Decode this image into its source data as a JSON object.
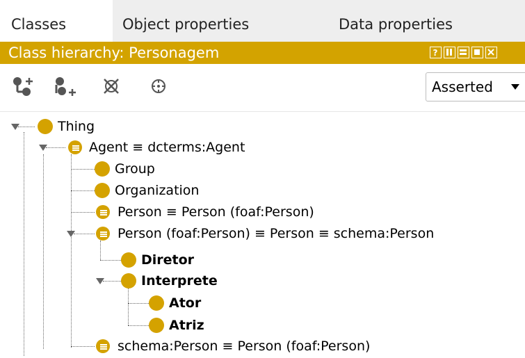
{
  "tabs": [
    {
      "label": "Classes",
      "active": true
    },
    {
      "label": "Object properties",
      "active": false
    },
    {
      "label": "Data properties",
      "active": false
    }
  ],
  "header": {
    "title": "Class hierarchy: Personagem",
    "color": "#d3a300"
  },
  "toolbar": {
    "icons": [
      "add-subclass-icon",
      "add-sibling-class-icon",
      "delete-class-icon",
      "target-icon"
    ],
    "dropdown_value": "Asserted"
  },
  "tree": {
    "thing": "Thing",
    "agent": "Agent ≡ dcterms:Agent",
    "group": "Group",
    "organization": "Organization",
    "person1": "Person ≡ Person (foaf:Person)",
    "person2": "Person (foaf:Person) ≡ Person ≡ schema:Person",
    "diretor": "Diretor",
    "interprete": "Interprete",
    "ator": "Ator",
    "atriz": "Atriz",
    "schema_person": "schema:Person ≡ Person (foaf:Person)"
  },
  "colors": {
    "class_circle": "#d4a200",
    "tab_inactive": "#eeeeee"
  }
}
